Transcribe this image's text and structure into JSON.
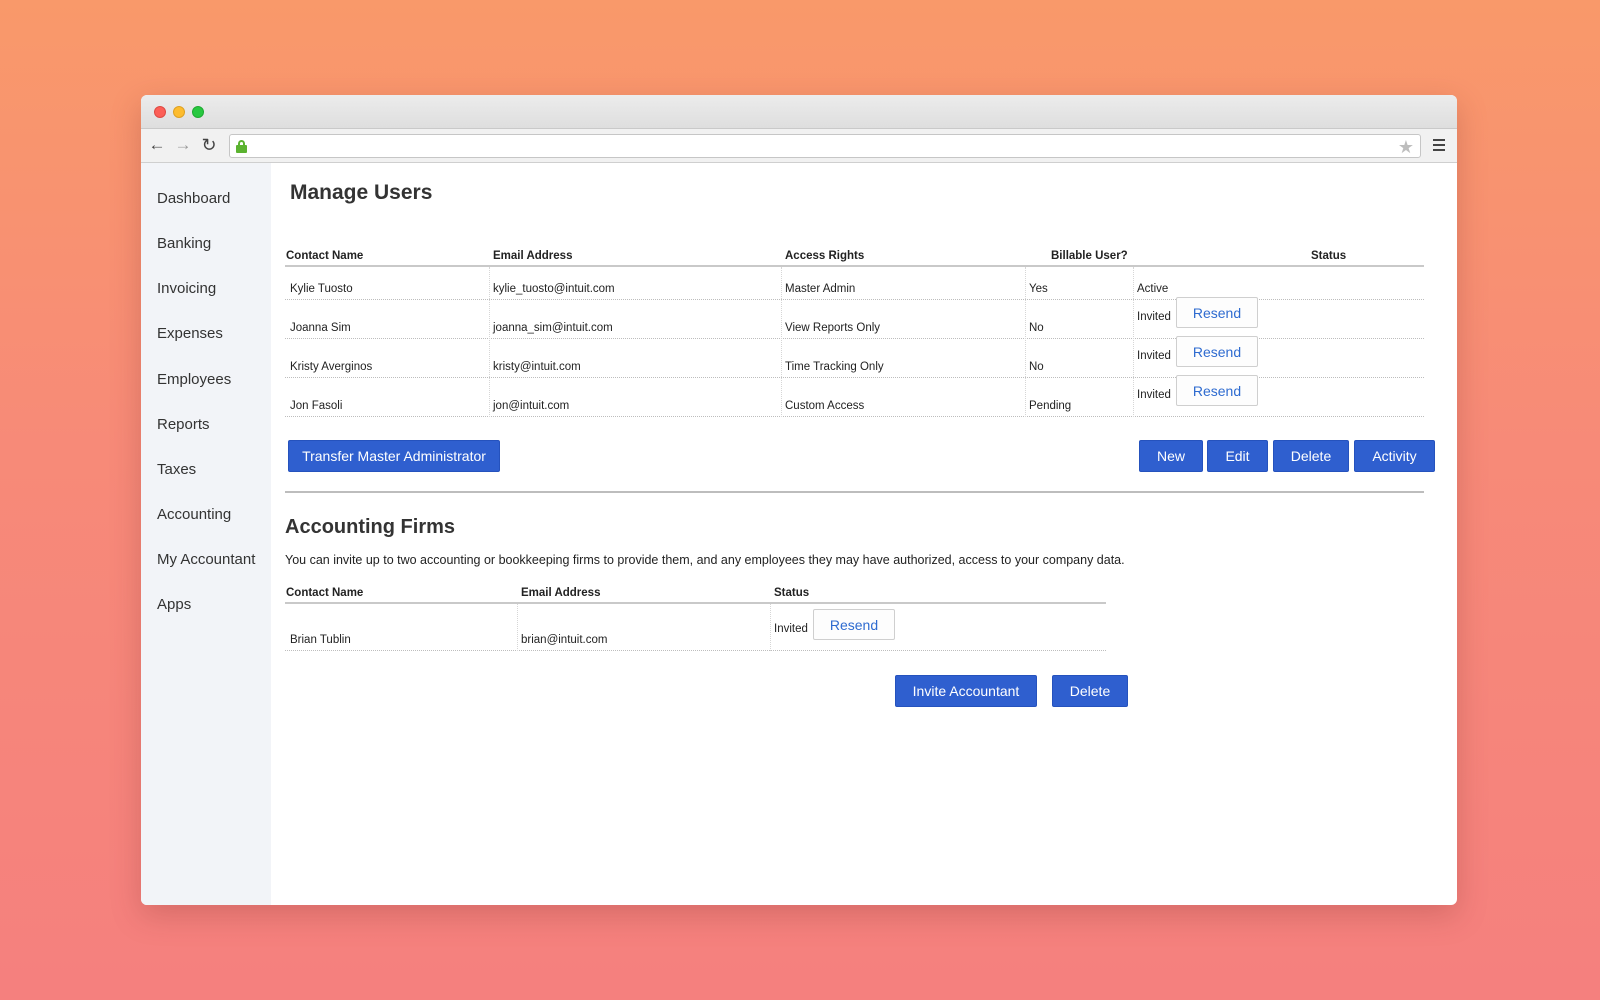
{
  "sidebar": {
    "items": [
      "Dashboard",
      "Banking",
      "Invoicing",
      "Expenses",
      "Employees",
      "Reports",
      "Taxes",
      "Accounting",
      "My Accountant",
      "Apps"
    ]
  },
  "manage_users": {
    "title": "Manage Users",
    "columns": [
      "Contact Name",
      "Email Address",
      "Access Rights",
      "Billable User?",
      "Status"
    ],
    "rows": [
      {
        "name": "Kylie Tuosto",
        "email": "kylie_tuosto@intuit.com",
        "access": "Master Admin",
        "billable": "Yes",
        "status": "Active",
        "action": ""
      },
      {
        "name": "Joanna Sim",
        "email": "joanna_sim@intuit.com",
        "access": "View Reports Only",
        "billable": "No",
        "status": "Invited",
        "action": "Resend"
      },
      {
        "name": "Kristy Averginos",
        "email": "kristy@intuit.com",
        "access": "Time Tracking Only",
        "billable": "No",
        "status": "Invited",
        "action": "Resend"
      },
      {
        "name": "Jon Fasoli",
        "email": "jon@intuit.com",
        "access": "Custom Access",
        "billable": "Pending",
        "status": "Invited",
        "action": "Resend"
      }
    ],
    "buttons": {
      "transfer": "Transfer Master Administrator",
      "new": "New",
      "edit": "Edit",
      "delete": "Delete",
      "activity": "Activity"
    }
  },
  "accounting_firms": {
    "title": "Accounting Firms",
    "description": "You can invite up to two accounting or bookkeeping firms to provide them, and any employees they may have authorized, access to your company data.",
    "columns": [
      "Contact Name",
      "Email Address",
      "Status"
    ],
    "rows": [
      {
        "name": "Brian Tublin",
        "email": "brian@intuit.com",
        "status": "Invited",
        "action": "Resend"
      }
    ],
    "buttons": {
      "invite": "Invite Accountant",
      "delete": "Delete"
    }
  },
  "colors": {
    "primary_button": "#2f5fcf",
    "link_text": "#2e6bd0",
    "sidebar_bg": "#f2f4f8"
  }
}
